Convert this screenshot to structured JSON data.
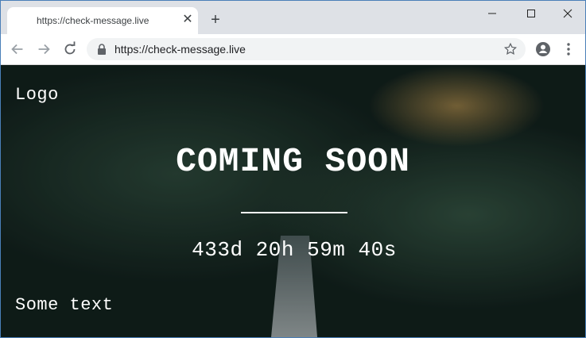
{
  "browser": {
    "tab_title": "https://check-message.live",
    "tab_close": "✕",
    "new_tab": "+",
    "url": "https://check-message.live"
  },
  "page": {
    "logo": "Logo",
    "heading": "COMING SOON",
    "countdown": "433d 20h 59m 40s",
    "footer_text": "Some text"
  },
  "colors": {
    "frame_border": "#4a7fb8",
    "tab_strip": "#dee1e6",
    "toolbar": "#ffffff",
    "omnibox": "#f1f3f4",
    "forest_dark": "#12211d",
    "forest_light": "#2e4a3c",
    "autumn_tree": "#a8874a",
    "page_text": "#ffffff"
  },
  "icons": [
    "back-icon",
    "forward-icon",
    "reload-icon",
    "lock-icon",
    "star-icon",
    "profile-icon",
    "menu-icon",
    "minimize-icon",
    "maximize-icon",
    "close-icon"
  ]
}
